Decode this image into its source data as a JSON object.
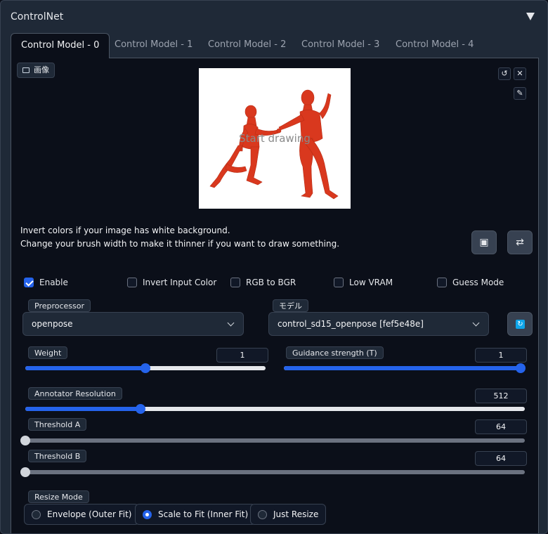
{
  "header": {
    "title": "ControlNet"
  },
  "tabs": [
    {
      "label": "Control Model - 0",
      "active": true
    },
    {
      "label": "Control Model - 1"
    },
    {
      "label": "Control Model - 2"
    },
    {
      "label": "Control Model - 3"
    },
    {
      "label": "Control Model - 4"
    }
  ],
  "image_panel": {
    "label": "画像",
    "canvas_placeholder": "Start drawing",
    "icons": [
      "image-icon",
      "undo-icon",
      "close-icon",
      "brush-icon"
    ]
  },
  "notes": {
    "line1": "Invert colors if your image has white background.",
    "line2": "Change your brush width to make it thinner if you want to draw something."
  },
  "buttons": {
    "camera_icon": "camera-icon",
    "swap_icon": "swap-arrows-icon",
    "refresh_icon": "refresh-icon"
  },
  "checkboxes": [
    {
      "label": "Enable",
      "checked": true
    },
    {
      "label": "Invert Input Color",
      "checked": false
    },
    {
      "label": "RGB to BGR",
      "checked": false
    },
    {
      "label": "Low VRAM",
      "checked": false
    },
    {
      "label": "Guess Mode",
      "checked": false
    }
  ],
  "preprocessor": {
    "label": "Preprocessor",
    "value": "openpose"
  },
  "model": {
    "label": "モデル",
    "value": "control_sd15_openpose [fef5e48e]"
  },
  "sliders": {
    "weight": {
      "label": "Weight",
      "value": "1",
      "fraction": 0.5
    },
    "guidance": {
      "label": "Guidance strength (T)",
      "value": "1",
      "fraction": 1.0
    },
    "annotator": {
      "label": "Annotator Resolution",
      "value": "512",
      "fraction": 0.23
    },
    "threshold_a": {
      "label": "Threshold A",
      "value": "64",
      "fraction": 0.0
    },
    "threshold_b": {
      "label": "Threshold B",
      "value": "64",
      "fraction": 0.0
    }
  },
  "resize_mode": {
    "label": "Resize Mode",
    "options": [
      {
        "label": "Envelope (Outer Fit)",
        "selected": false
      },
      {
        "label": "Scale to Fit (Inner Fit)",
        "selected": true
      },
      {
        "label": "Just Resize",
        "selected": false
      }
    ]
  },
  "colors": {
    "accent": "#2563eb",
    "figure": "#d9381e",
    "background": "#0b0f19"
  }
}
